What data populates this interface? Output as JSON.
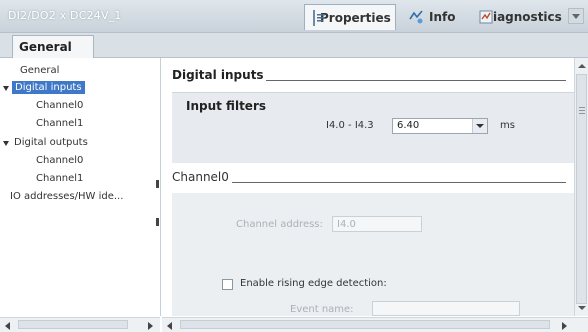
{
  "window": {
    "device_title": "DI2/DO2 x DC24V_1"
  },
  "inspector_tabs": [
    {
      "label": "Properties",
      "icon": "properties-icon",
      "active": true
    },
    {
      "label": "Info",
      "icon": "info-icon",
      "active": false
    },
    {
      "label": "Diagnostics",
      "icon": "diagnostics-icon",
      "active": false
    }
  ],
  "subtabs": {
    "general": "General"
  },
  "nav": {
    "items": [
      {
        "label": "General",
        "level": 0,
        "expandable": false,
        "selected": false
      },
      {
        "label": "Digital inputs",
        "level": 0,
        "expandable": true,
        "selected": true
      },
      {
        "label": "Channel0",
        "level": 1,
        "expandable": false,
        "selected": false
      },
      {
        "label": "Channel1",
        "level": 1,
        "expandable": false,
        "selected": false
      },
      {
        "label": "Digital outputs",
        "level": 0,
        "expandable": true,
        "selected": false
      },
      {
        "label": "Channel0",
        "level": 1,
        "expandable": false,
        "selected": false
      },
      {
        "label": "Channel1",
        "level": 1,
        "expandable": false,
        "selected": false
      },
      {
        "label": "IO addresses/HW ide...",
        "level": 0,
        "expandable": false,
        "selected": false
      }
    ]
  },
  "content": {
    "section_title": "Digital inputs",
    "input_filters": {
      "title": "Input filters",
      "range_label": "I4.0 - I4.3",
      "value": "6.40",
      "unit": "ms"
    },
    "channel0": {
      "title": "Channel0",
      "channel_address_label": "Channel address:",
      "channel_address_value": "I4.0",
      "rising_edge_label": "Enable rising edge detection:",
      "rising_edge_checked": false,
      "event_name_label": "Event name:"
    }
  },
  "colors": {
    "selection": "#3e78c6",
    "panel": "#e7ebef",
    "titlebar": "#c9d2da"
  }
}
